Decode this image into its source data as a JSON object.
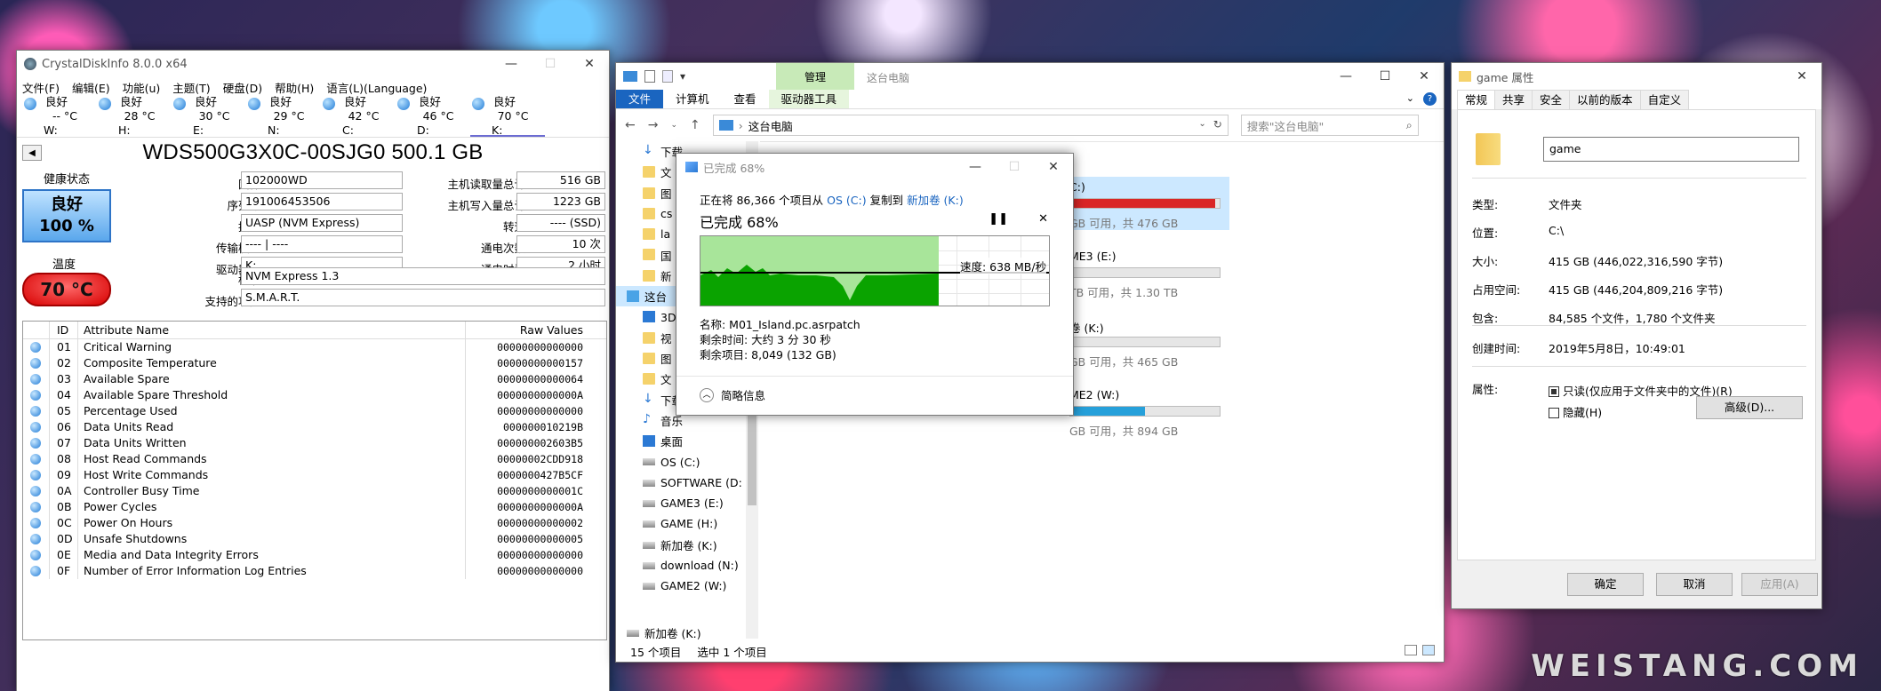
{
  "watermark": "WEISTANG.COM",
  "cdi": {
    "title": "CrystalDiskInfo 8.0.0 x64",
    "menu": [
      "文件(F)",
      "编辑(E)",
      "功能(u)",
      "主题(T)",
      "硬盘(D)",
      "帮助(H)",
      "语言(L)(Language)"
    ],
    "drives": [
      {
        "status": "良好",
        "temp": "-- °C",
        "letter": "W:"
      },
      {
        "status": "良好",
        "temp": "28 °C",
        "letter": "H:"
      },
      {
        "status": "良好",
        "temp": "30 °C",
        "letter": "E:"
      },
      {
        "status": "良好",
        "temp": "29 °C",
        "letter": "N:"
      },
      {
        "status": "良好",
        "temp": "42 °C",
        "letter": "C:"
      },
      {
        "status": "良好",
        "temp": "46 °C",
        "letter": "D:"
      },
      {
        "status": "良好",
        "temp": "70 °C",
        "letter": "K:"
      }
    ],
    "model": "WDS500G3X0C-00SJG0 500.1 GB",
    "health_label": "健康状态",
    "health_status": "良好",
    "health_pct": "100 %",
    "temp_label": "温度",
    "temp_value": "70 °C",
    "info_left": [
      {
        "k": "固件",
        "v": "102000WD"
      },
      {
        "k": "序列号",
        "v": "191006453506"
      },
      {
        "k": "接口",
        "v": "UASP (NVM Express)"
      },
      {
        "k": "传输模式",
        "v": "---- | ----"
      },
      {
        "k": "驱动器号",
        "v": "K:"
      }
    ],
    "info_right": [
      {
        "k": "主机读取量总计",
        "v": "516 GB"
      },
      {
        "k": "主机写入量总计",
        "v": "1223 GB"
      },
      {
        "k": "转速",
        "v": "---- (SSD)"
      },
      {
        "k": "通电次数",
        "v": "10 次"
      },
      {
        "k": "通电时间",
        "v": "2 小时"
      }
    ],
    "standard_label": "标准",
    "standard_value": "NVM Express 1.3",
    "features_label": "支持的功能",
    "features_value": "S.M.A.R.T.",
    "attr_headers": {
      "id": "ID",
      "name": "Attribute Name",
      "raw": "Raw Values"
    },
    "attrs": [
      {
        "id": "01",
        "name": "Critical Warning",
        "raw": "00000000000000"
      },
      {
        "id": "02",
        "name": "Composite Temperature",
        "raw": "00000000000157"
      },
      {
        "id": "03",
        "name": "Available Spare",
        "raw": "00000000000064"
      },
      {
        "id": "04",
        "name": "Available Spare Threshold",
        "raw": "0000000000000A"
      },
      {
        "id": "05",
        "name": "Percentage Used",
        "raw": "00000000000000"
      },
      {
        "id": "06",
        "name": "Data Units Read",
        "raw": "000000010219B"
      },
      {
        "id": "07",
        "name": "Data Units Written",
        "raw": "000000002603B5"
      },
      {
        "id": "08",
        "name": "Host Read Commands",
        "raw": "00000002CDD918"
      },
      {
        "id": "09",
        "name": "Host Write Commands",
        "raw": "0000000427B5CF"
      },
      {
        "id": "0A",
        "name": "Controller Busy Time",
        "raw": "0000000000001C"
      },
      {
        "id": "0B",
        "name": "Power Cycles",
        "raw": "0000000000000A"
      },
      {
        "id": "0C",
        "name": "Power On Hours",
        "raw": "00000000000002"
      },
      {
        "id": "0D",
        "name": "Unsafe Shutdowns",
        "raw": "00000000000005"
      },
      {
        "id": "0E",
        "name": "Media and Data Integrity Errors",
        "raw": "00000000000000"
      },
      {
        "id": "0F",
        "name": "Number of Error Information Log Entries",
        "raw": "00000000000000"
      }
    ]
  },
  "explorer": {
    "manage_tab": "管理",
    "window_title": "这台电脑",
    "tabs": [
      "文件",
      "计算机",
      "查看",
      "驱动器工具"
    ],
    "address": "这台电脑",
    "search_placeholder": "搜索\"这台电脑\"",
    "nav": [
      {
        "label": "下载",
        "icon": "down",
        "sub": true
      },
      {
        "label": "文",
        "icon": "folder",
        "sub": true
      },
      {
        "label": "图",
        "icon": "folder",
        "sub": true
      },
      {
        "label": "cs",
        "icon": "folder",
        "sub": true
      },
      {
        "label": "la",
        "icon": "folder",
        "sub": true
      },
      {
        "label": "国",
        "icon": "folder",
        "sub": true
      },
      {
        "label": "新",
        "icon": "folder",
        "sub": true
      },
      {
        "label": "这台",
        "icon": "pc",
        "sub": false,
        "sel": true
      },
      {
        "label": "3D",
        "icon": "blue",
        "sub": true
      },
      {
        "label": "视",
        "icon": "folder",
        "sub": true
      },
      {
        "label": "图",
        "icon": "folder",
        "sub": true
      },
      {
        "label": "文",
        "icon": "folder",
        "sub": true
      },
      {
        "label": "下载",
        "icon": "down",
        "sub": true
      },
      {
        "label": "音乐",
        "icon": "music",
        "sub": true
      },
      {
        "label": "桌面",
        "icon": "blue",
        "sub": true
      },
      {
        "label": "OS (C:)",
        "icon": "drive",
        "sub": true
      },
      {
        "label": "SOFTWARE (D:",
        "icon": "drive",
        "sub": true
      },
      {
        "label": "GAME3 (E:)",
        "icon": "drive",
        "sub": true
      },
      {
        "label": "GAME (H:)",
        "icon": "drive",
        "sub": true
      },
      {
        "label": "新加卷 (K:)",
        "icon": "drive",
        "sub": true
      },
      {
        "label": "download (N:)",
        "icon": "drive",
        "sub": true
      },
      {
        "label": "GAME2 (W:)",
        "icon": "drive",
        "sub": true
      }
    ],
    "nav_bottom": "新加卷 (K:)",
    "drives": [
      {
        "name": "C:)",
        "space": "GB 可用，共 476 GB",
        "fill": 0.97,
        "red": true,
        "sel": true
      },
      {
        "name": "ME3 (E:)",
        "space": "TB 可用，共 1.30 TB",
        "fill": 0,
        "red": false,
        "sel": false
      },
      {
        "name": "卷 (K:)",
        "space": "GB 可用，共 465 GB",
        "fill": 0,
        "red": false,
        "sel": false
      },
      {
        "name": "ME2 (W:)",
        "space": "GB 可用，共 894 GB",
        "fill": 0.5,
        "red": false,
        "sel": false
      }
    ],
    "status_count": "15 个项目",
    "status_sel": "选中 1 个项目"
  },
  "copy": {
    "title": "已完成 68%",
    "line_pre": "正在将 86,366 个项目从 ",
    "src": "OS (C:)",
    "line_mid": " 复制到 ",
    "dst": "新加卷 (K:)",
    "pct": "已完成 68%",
    "progress": 0.68,
    "speed": "速度: 638 MB/秒",
    "name_line": "名称: M01_Island.pc.asrpatch",
    "time_line": "剩余时间: 大约 3 分 30 秒",
    "items_line": "剩余项目: 8,049 (132 GB)",
    "less_info": "简略信息"
  },
  "props": {
    "title": "game 属性",
    "tabs": [
      "常规",
      "共享",
      "安全",
      "以前的版本",
      "自定义"
    ],
    "name": "game",
    "rows": [
      {
        "k": "类型:",
        "v": "文件夹"
      },
      {
        "k": "位置:",
        "v": "C:\\"
      },
      {
        "k": "大小:",
        "v": "415 GB (446,022,316,590 字节)"
      },
      {
        "k": "占用空间:",
        "v": "415 GB (446,204,809,216 字节)"
      },
      {
        "k": "包含:",
        "v": "84,585 个文件，1,780 个文件夹"
      }
    ],
    "created_k": "创建时间:",
    "created_v": "2019年5月8日，10:49:01",
    "attr_k": "属性:",
    "readonly": "只读(仅应用于文件夹中的文件)(R)",
    "hidden": "隐藏(H)",
    "advanced": "高级(D)...",
    "ok": "确定",
    "cancel": "取消",
    "apply": "应用(A)"
  }
}
